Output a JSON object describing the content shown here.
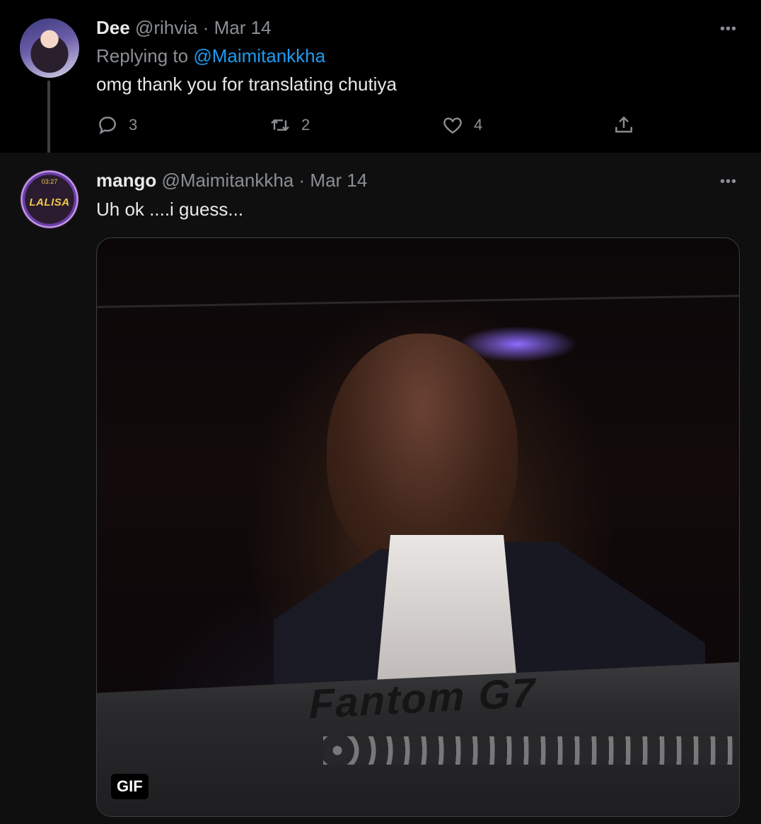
{
  "tweets": [
    {
      "name": "Dee",
      "handle": "@rihvia",
      "date": "Mar 14",
      "replying_prefix": "Replying to",
      "replying_to": "@Maimitankkha",
      "text": "omg thank you for translating chutiya",
      "more": "•••",
      "actions": {
        "reply_count": "3",
        "retweet_count": "2",
        "like_count": "4"
      }
    },
    {
      "name": "mango",
      "handle": "@Maimitankkha",
      "date": "Mar 14",
      "text": "Uh ok ....i guess...",
      "more": "•••",
      "media": {
        "badge": "GIF",
        "brand_text": "Fantom G7"
      },
      "avatar": {
        "time": "03:27",
        "label": "LALISA"
      }
    }
  ],
  "colors": {
    "accent": "#1d9bf0",
    "muted": "#8b8f94",
    "text": "#e7e9ea",
    "background": "#000000"
  },
  "icons": [
    "reply-icon",
    "retweet-icon",
    "like-icon",
    "share-icon",
    "more-icon"
  ]
}
